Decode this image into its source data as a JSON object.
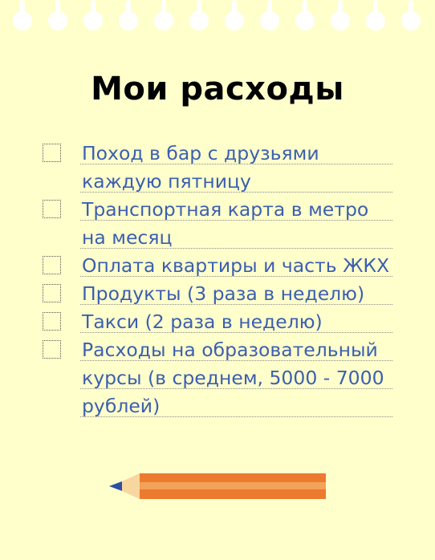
{
  "title": "Мои расходы",
  "items": [
    {
      "lines": [
        "Поход в бар с друзьями",
        "каждую пятницу"
      ],
      "checked": false
    },
    {
      "lines": [
        "Транспортная карта в метро",
        "на месяц"
      ],
      "checked": false
    },
    {
      "lines": [
        "Оплата квартиры и часть ЖКХ"
      ],
      "checked": false
    },
    {
      "lines": [
        "Продукты (3 раза в неделю)"
      ],
      "checked": false
    },
    {
      "lines": [
        "Такси (2 раза в неделю)"
      ],
      "checked": false
    },
    {
      "lines": [
        "Расходы на образовательный",
        "курсы (в среднем, 5000 - 7000",
        "рублей)"
      ],
      "checked": false
    }
  ],
  "colors": {
    "background": "#ffffcc",
    "text": "#3b5fb0",
    "pencil_body": "#ec7a2f",
    "pencil_stripe": "#f3a25a",
    "pencil_tip": "#f7d6a0",
    "pencil_lead": "#2c4ea3"
  }
}
